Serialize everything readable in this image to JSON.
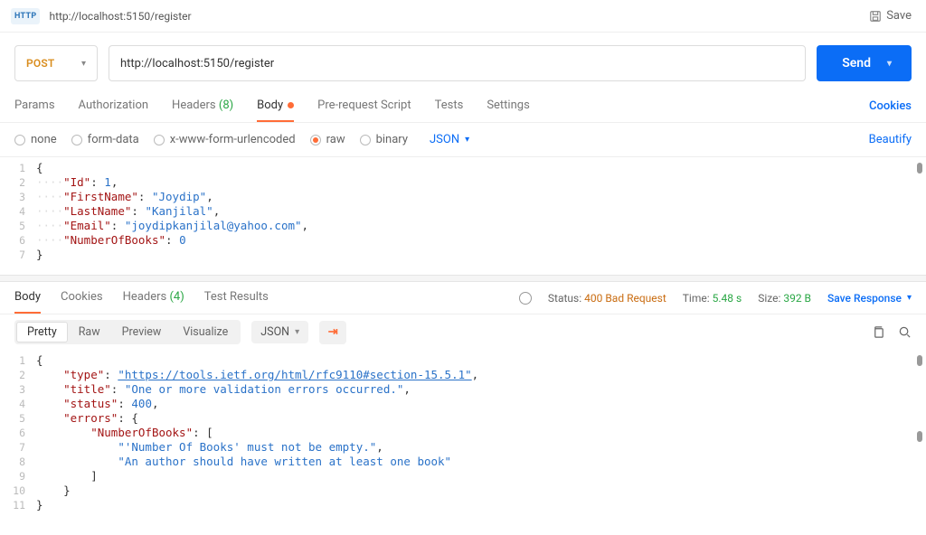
{
  "top": {
    "badge": "HTTP",
    "url_breadcrumb": "http://localhost:5150/register",
    "save_label": "Save"
  },
  "request": {
    "method": "POST",
    "url": "http://localhost:5150/register",
    "send_label": "Send"
  },
  "tabs": {
    "params": "Params",
    "auth": "Authorization",
    "headers": "Headers",
    "headers_count": "(8)",
    "body": "Body",
    "prerequest": "Pre-request Script",
    "tests": "Tests",
    "settings": "Settings",
    "cookies_link": "Cookies"
  },
  "body_types": {
    "none": "none",
    "formdata": "form-data",
    "urlenc": "x-www-form-urlencoded",
    "raw": "raw",
    "binary": "binary",
    "format": "JSON",
    "beautify": "Beautify"
  },
  "request_body_lines": {
    "l1": "{",
    "l2_key": "\"Id\"",
    "l2_rest": ": ",
    "l2_val": "1",
    "l2_end": ",",
    "l3_key": "\"FirstName\"",
    "l3_rest": ": ",
    "l3_val": "\"Joydip\"",
    "l3_end": ",",
    "l4_key": "\"LastName\"",
    "l4_rest": ": ",
    "l4_val": "\"Kanjilal\"",
    "l4_end": ",",
    "l5_key": "\"Email\"",
    "l5_rest": ": ",
    "l5_val": "\"joydipkanjilal@yahoo.com\"",
    "l5_end": ",",
    "l6_key": "\"NumberOfBooks\"",
    "l6_rest": ": ",
    "l6_val": "0",
    "l7": "}"
  },
  "response_tabs": {
    "body": "Body",
    "cookies": "Cookies",
    "headers": "Headers",
    "headers_count": "(4)",
    "tests": "Test Results"
  },
  "response_meta": {
    "status_label": "Status:",
    "status_value": "400 Bad Request",
    "time_label": "Time:",
    "time_value": "5.48 s",
    "size_label": "Size:",
    "size_value": "392 B",
    "save_response": "Save Response"
  },
  "response_view": {
    "pretty": "Pretty",
    "raw": "Raw",
    "preview": "Preview",
    "visualize": "Visualize",
    "format": "JSON"
  },
  "response_body_lines": {
    "r1": "{",
    "r2_key": "\"type\"",
    "r2_sep": ": ",
    "r2_val": "\"https://tools.ietf.org/html/rfc9110#section-15.5.1\"",
    "r2_end": ",",
    "r3_key": "\"title\"",
    "r3_sep": ": ",
    "r3_val": "\"One or more validation errors occurred.\"",
    "r3_end": ",",
    "r4_key": "\"status\"",
    "r4_sep": ": ",
    "r4_val": "400",
    "r4_end": ",",
    "r5_key": "\"errors\"",
    "r5_sep": ": ",
    "r5_val": "{",
    "r6_key": "\"NumberOfBooks\"",
    "r6_sep": ": ",
    "r6_val": "[",
    "r7_val": "\"'Number Of Books' must not be empty.\"",
    "r7_end": ",",
    "r8_val": "\"An author should have written at least one book\"",
    "r9": "]",
    "r10": "}",
    "r11": "}"
  }
}
